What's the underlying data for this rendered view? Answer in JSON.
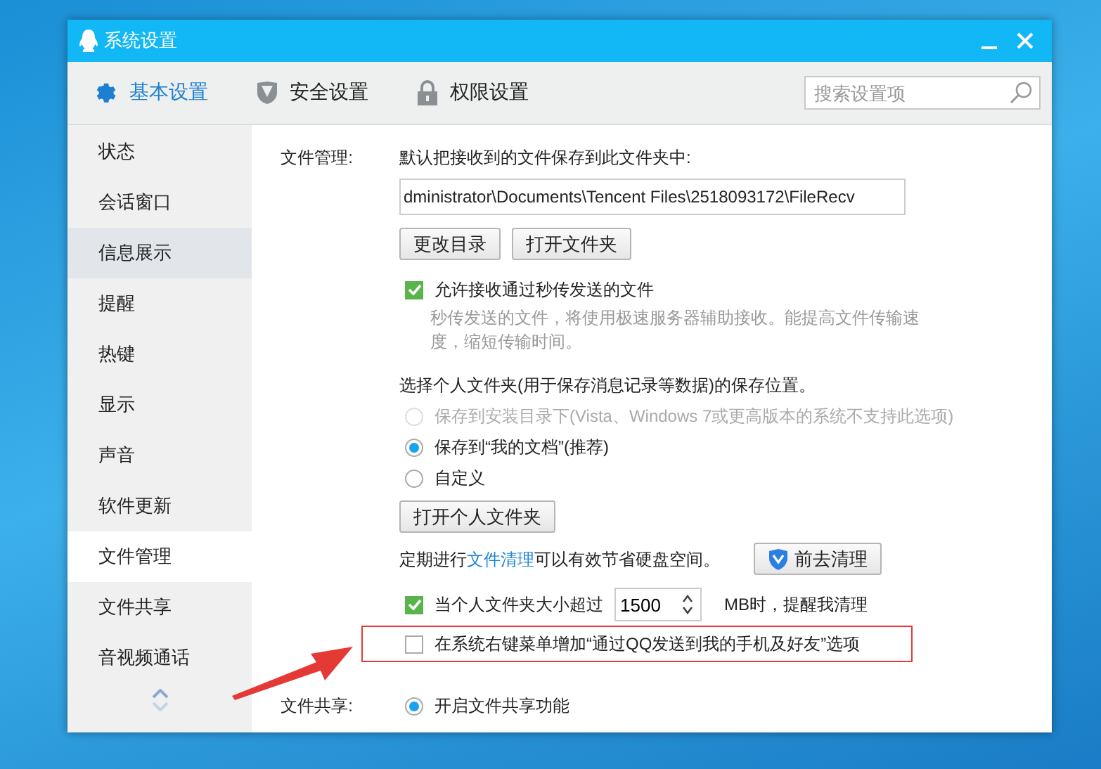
{
  "window": {
    "title": "系统设置"
  },
  "tabs": [
    {
      "label": "基本设置",
      "selected": true,
      "kind": "gear"
    },
    {
      "label": "安全设置",
      "selected": false,
      "kind": "shield"
    },
    {
      "label": "权限设置",
      "selected": false,
      "kind": "lock"
    }
  ],
  "search": {
    "placeholder": "搜索设置项"
  },
  "sidebar": {
    "items": [
      {
        "label": "状态",
        "selected": false,
        "hovered": false
      },
      {
        "label": "会话窗口",
        "selected": false,
        "hovered": false
      },
      {
        "label": "信息展示",
        "selected": false,
        "hovered": true
      },
      {
        "label": "提醒",
        "selected": false,
        "hovered": false
      },
      {
        "label": "热键",
        "selected": false,
        "hovered": false
      },
      {
        "label": "显示",
        "selected": false,
        "hovered": false
      },
      {
        "label": "声音",
        "selected": false,
        "hovered": false
      },
      {
        "label": "软件更新",
        "selected": false,
        "hovered": false
      },
      {
        "label": "文件管理",
        "selected": true,
        "hovered": false
      },
      {
        "label": "文件共享",
        "selected": false,
        "hovered": false
      },
      {
        "label": "音视频通话",
        "selected": false,
        "hovered": false
      }
    ]
  },
  "file_management": {
    "label": "文件管理:",
    "intro": "默认把接收到的文件保存到此文件夹中:",
    "path": "dministrator\\Documents\\Tencent Files\\2518093172\\FileRecv",
    "buttons": [
      "更改目录",
      "打开文件夹"
    ],
    "instant_transfer": {
      "label": "允许接收通过秒传发送的文件",
      "checked": true,
      "description": "秒传发送的文件，将使用极速服务器辅助接收。能提高文件传输速度，缩短传输时间。"
    },
    "folder_prompt": "选择个人文件夹(用于保存消息记录等数据)的保存位置。",
    "locations": [
      {
        "label": "保存到安装目录下(Vista、Windows 7或更高版本的系统不支持此选项)",
        "selected": false,
        "disabled": true
      },
      {
        "label": "保存到“我的文档”(推荐)",
        "selected": true,
        "disabled": false
      },
      {
        "label": "自定义",
        "selected": false,
        "disabled": false
      }
    ],
    "open_folder_button": "打开个人文件夹",
    "cleanup": {
      "before": "定期进行",
      "link": "文件清理",
      "after": "可以有效节省硬盘空间。",
      "button": "前去清理"
    },
    "size_alert": {
      "checked": true,
      "before": "当个人文件夹大小超过",
      "value": "1500",
      "after": "MB时，提醒我清理"
    },
    "context_menu": {
      "label": "在系统右键菜单增加“通过QQ发送到我的手机及好友”选项",
      "checked": false
    }
  },
  "file_sharing": {
    "label": "文件共享:",
    "options": [
      {
        "label": "开启文件共享功能",
        "selected": true
      }
    ]
  }
}
